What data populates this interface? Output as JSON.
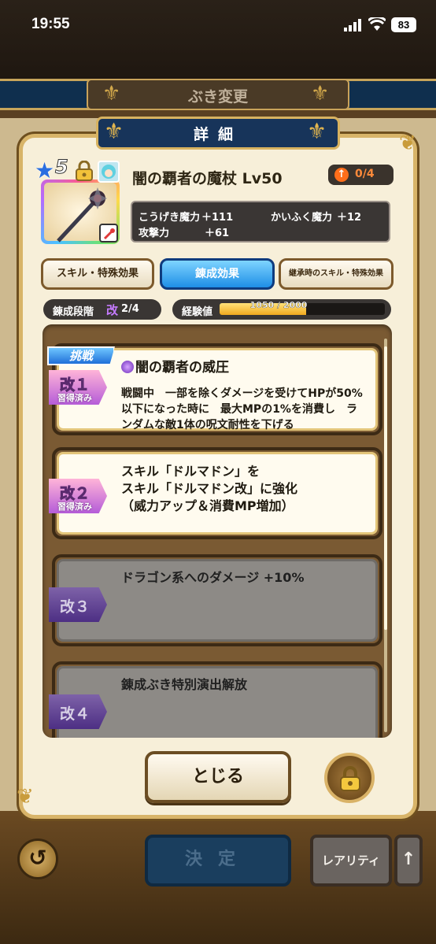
{
  "status_bar": {
    "time": "19:55",
    "battery": "83"
  },
  "screen": {
    "title": "ぶき変更"
  },
  "modal": {
    "title": "詳細",
    "weapon": {
      "rarity_stars": "5",
      "name": "闇の覇者の魔杖 Lv50",
      "upgrade": "0/4"
    },
    "stats": [
      {
        "label": "こうげき魔力",
        "value": "＋111"
      },
      {
        "label": "かいふく魔力",
        "value": "＋12"
      },
      {
        "label": "攻撃力",
        "value": "＋61"
      }
    ],
    "tabs": [
      {
        "label": "スキル・特殊効果",
        "active": false
      },
      {
        "label": "錬成効果",
        "active": true
      },
      {
        "label": "継承時のスキル・特殊効果",
        "active": false
      }
    ],
    "stage": {
      "label": "錬成段階",
      "kai": "改",
      "value": "2/4"
    },
    "exp": {
      "label": "経験値",
      "text": "1050 / 2000",
      "fraction": 0.525
    },
    "effects": [
      {
        "level": "改１",
        "learned": "習得済み",
        "challenge": "挑戦",
        "title": "闇の覇者の威圧",
        "lines": [
          "戦闘中　一部を除くダメージを受けてHPが50%",
          "以下になった時に　最大MPの1%を消費し　ラ",
          "ンダムな敵1体の呪文耐性を下げる"
        ]
      },
      {
        "level": "改２",
        "learned": "習得済み",
        "lines": [
          "スキル「ドルマドン」を",
          "スキル「ドルマドン改」に強化",
          "（威力アップ＆消費MP増加）"
        ]
      },
      {
        "level": "改３",
        "lines": [
          "ドラゴン系へのダメージ +10%"
        ]
      },
      {
        "level": "改４",
        "lines": [
          "錬成ぶき特別演出解放"
        ]
      }
    ],
    "close_label": "とじる"
  },
  "footer": {
    "decide_label": "決定",
    "rarity_label": "レアリティ",
    "sort_label": "↑"
  }
}
